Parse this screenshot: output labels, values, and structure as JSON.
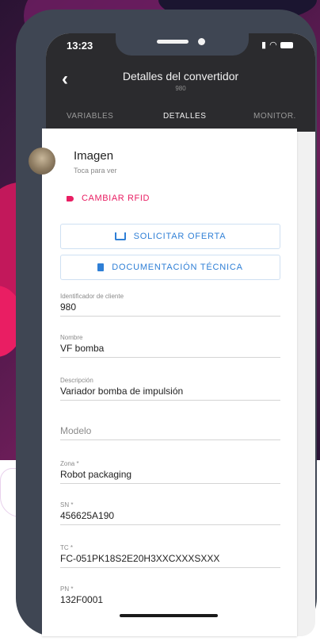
{
  "status_bar": {
    "time": "13:23"
  },
  "header": {
    "title": "Detalles del convertidor",
    "subtitle": "980"
  },
  "tabs": [
    {
      "label": "VARIABLES"
    },
    {
      "label": "DETALLES"
    },
    {
      "label": "MONITOR."
    }
  ],
  "image": {
    "title": "Imagen",
    "subtitle": "Toca para ver"
  },
  "actions": {
    "rfid_label": "CAMBIAR RFID",
    "offer_label": "SOLICITAR OFERTA",
    "docs_label": "DOCUMENTACIÓN TÉCNICA"
  },
  "fields": [
    {
      "label": "Identificador de cliente",
      "value": "980"
    },
    {
      "label": "Nombre",
      "value": "VF bomba"
    },
    {
      "label": "Descripción",
      "value": "Variador bomba de impulsión"
    },
    {
      "placeholder": "Modelo"
    },
    {
      "label": "Zona *",
      "value": "Robot packaging"
    },
    {
      "label": "SN *",
      "value": "456625A190"
    },
    {
      "label": "TC *",
      "value": "FC-051PK18S2E20H3XXCXXXSXXX"
    },
    {
      "label": "PN *",
      "value": "132F0001"
    }
  ],
  "colors": {
    "accent": "#e91e63",
    "link": "#2f7fd6",
    "header": "#2b2b2e"
  }
}
